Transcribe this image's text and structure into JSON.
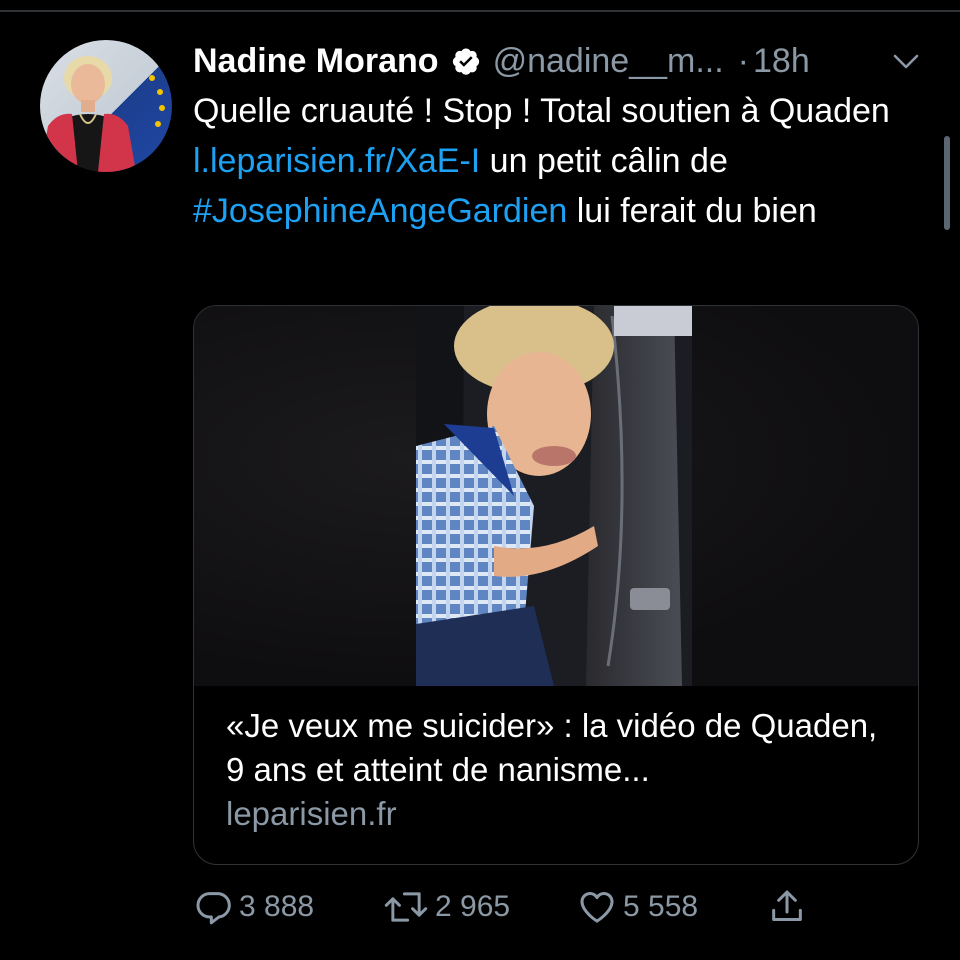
{
  "tweet": {
    "author_name": "Nadine Morano",
    "handle": "@nadine__m...",
    "separator": "·",
    "time": "18h",
    "text_parts": {
      "t1": "Quelle cruauté ! Stop ! Total soutien à Quaden ",
      "link": "l.leparisien.fr/XaE-I",
      "t2": " un petit câlin de ",
      "hashtag": "#JosephineAngeGardien",
      "t3": " lui ferait du bien"
    }
  },
  "card": {
    "title": "«Je veux me suicider» : la vidéo de Quaden, 9 ans et atteint de nanisme...",
    "domain": "leparisien.fr"
  },
  "actions": {
    "replies": "3 888",
    "retweets": "2 965",
    "likes": "5 558"
  },
  "icons": {
    "verified": "verified-badge-icon",
    "caret": "chevron-down-icon",
    "reply": "reply-icon",
    "retweet": "retweet-icon",
    "like": "heart-icon",
    "share": "share-icon"
  },
  "colors": {
    "background": "#000000",
    "text": "#ffffff",
    "secondary": "#8b98a5",
    "link": "#1da1f2",
    "border": "#2f3336"
  }
}
